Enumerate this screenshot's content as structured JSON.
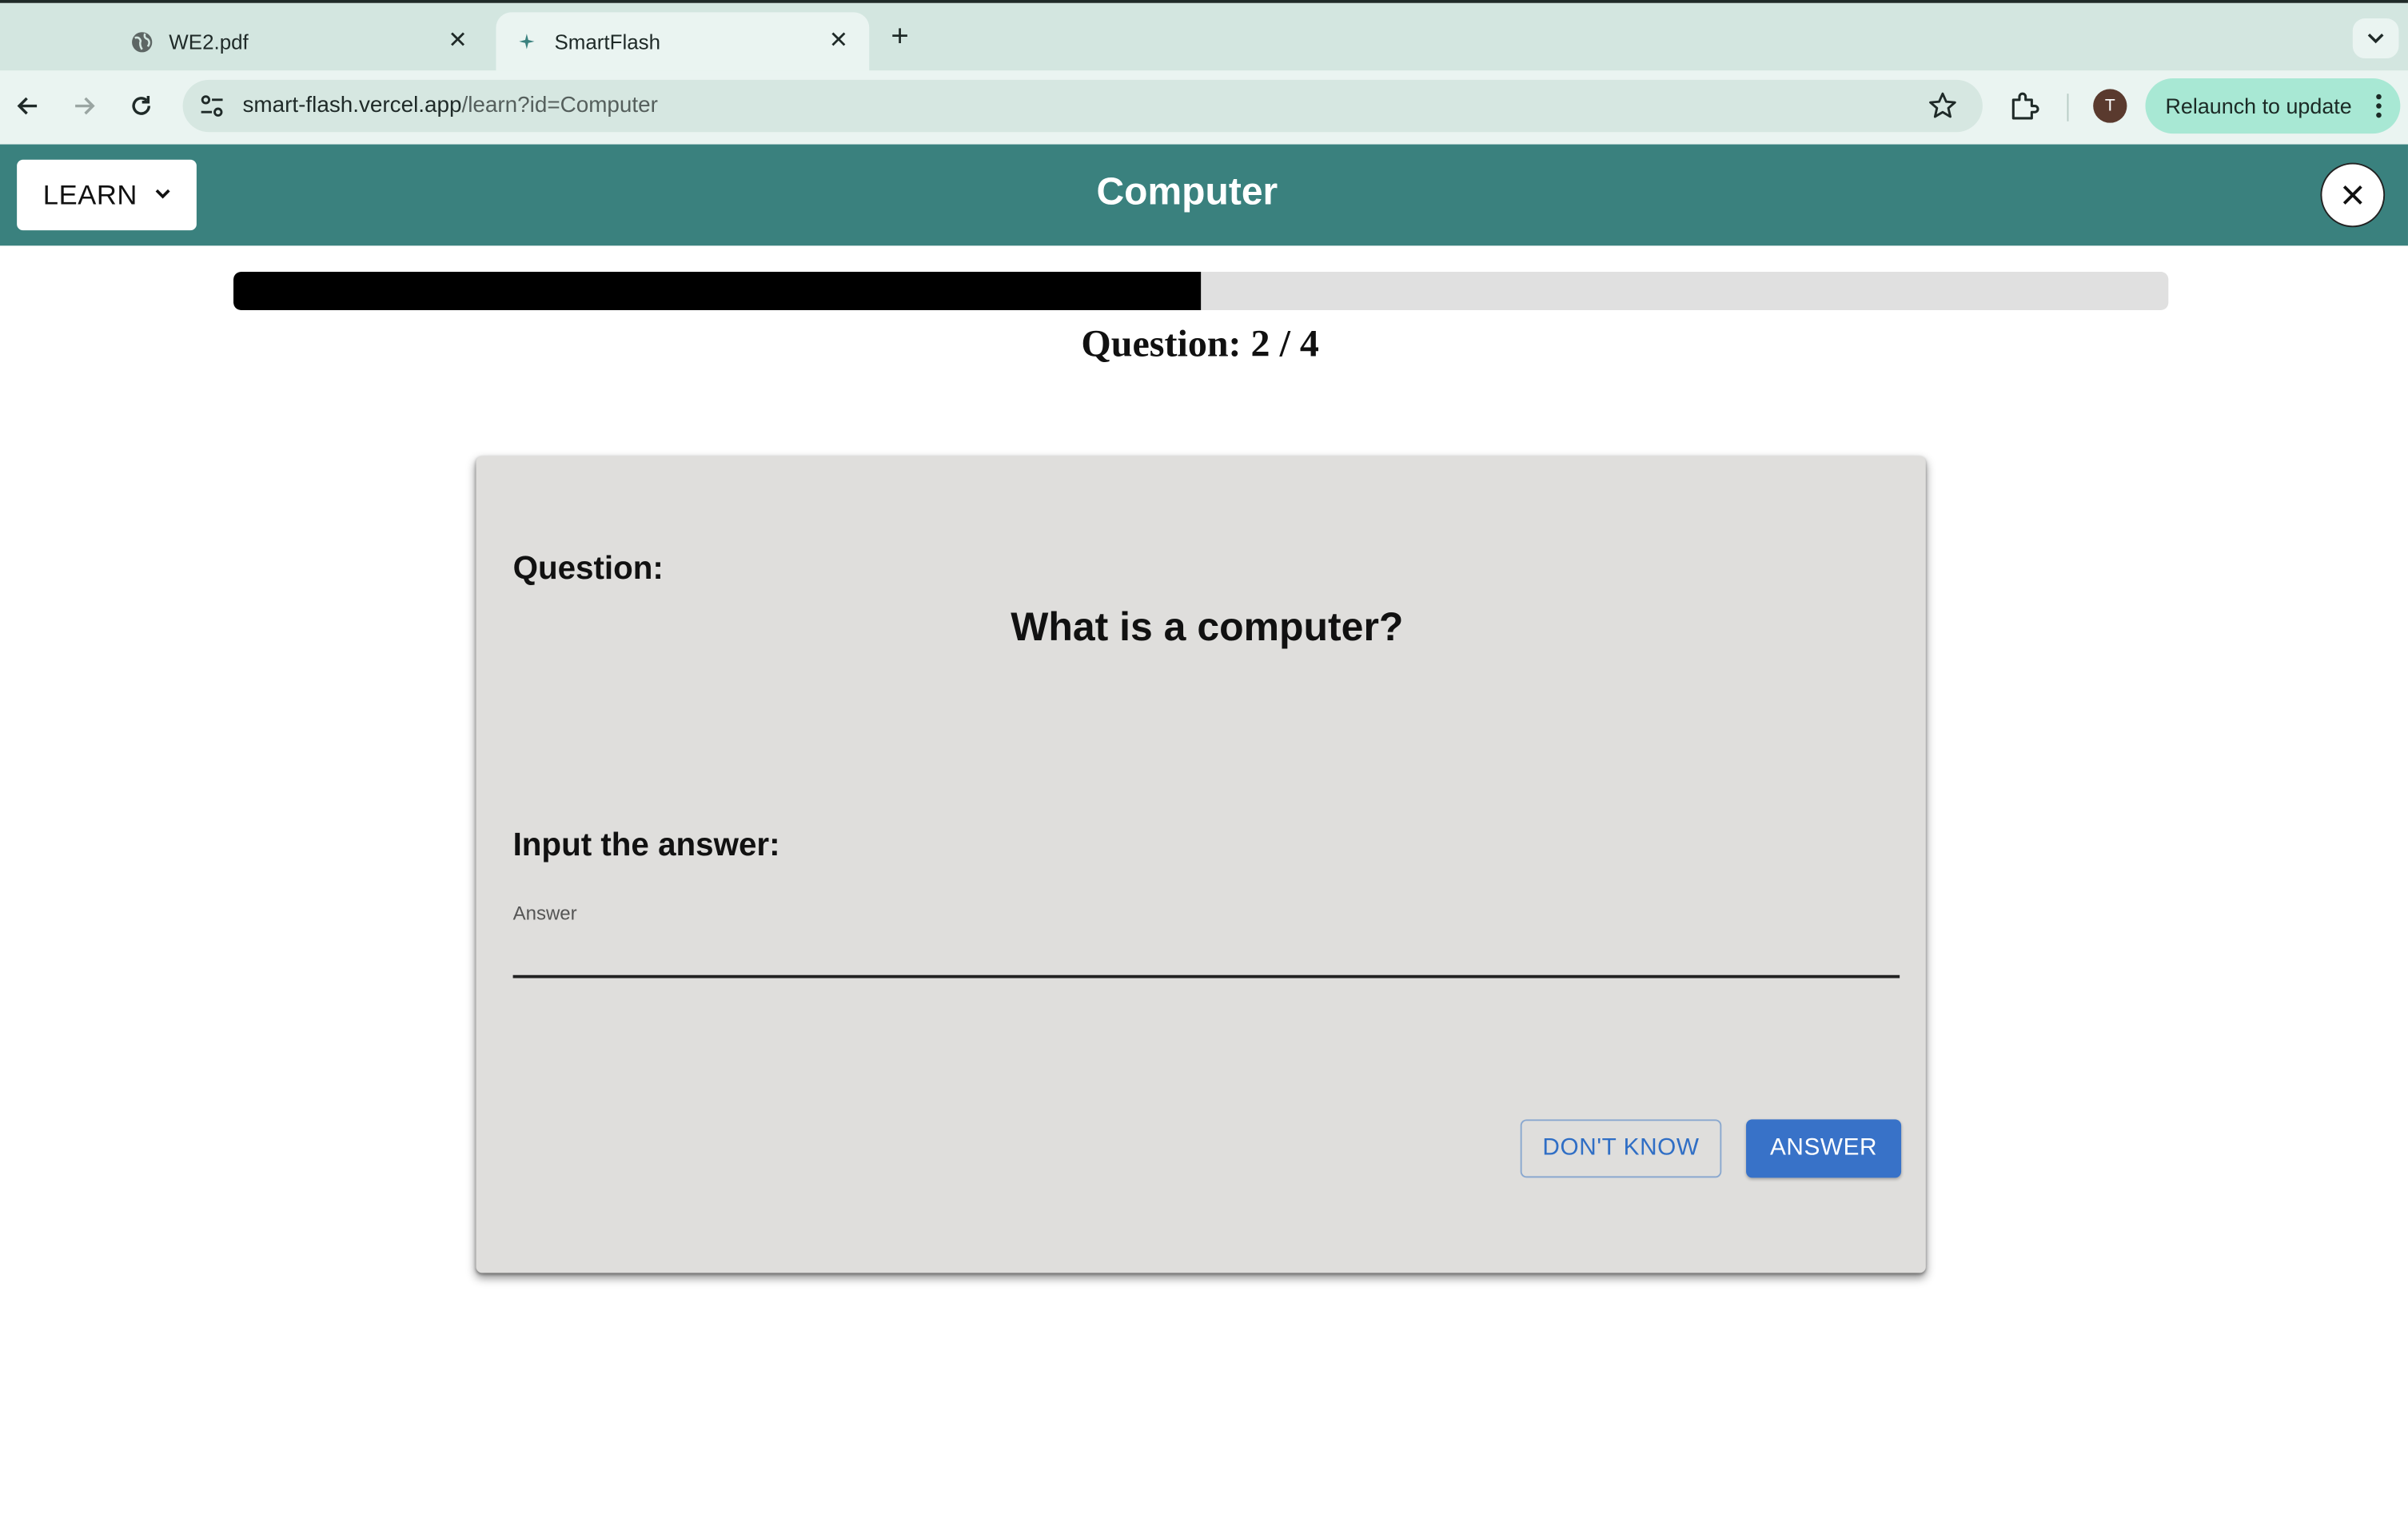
{
  "browser": {
    "tabs": [
      {
        "title": "WE2.pdf",
        "favicon": "globe-icon",
        "active": false
      },
      {
        "title": "SmartFlash",
        "favicon": "smartflash-favicon",
        "active": true
      }
    ],
    "url_host": "smart-flash.vercel.app",
    "url_path": "/learn?id=Computer",
    "profile_initial": "T",
    "relaunch_label": "Relaunch to update"
  },
  "app": {
    "mode_label": "LEARN",
    "title": "Computer",
    "progress_fraction": 0.5,
    "question_count": "Question: 2 / 4"
  },
  "card": {
    "question_label": "Question:",
    "question_text": "What is a computer?",
    "input_label": "Input the answer:",
    "answer_field_label": "Answer",
    "answer_value": "",
    "dont_know_label": "DON'T KNOW",
    "answer_button_label": "ANSWER"
  },
  "colors": {
    "app_header": "#3a817e",
    "card_background": "#dfdedc",
    "primary_button": "#3872c8",
    "progress_fill": "#000000",
    "progress_track": "#e0e0e0"
  }
}
